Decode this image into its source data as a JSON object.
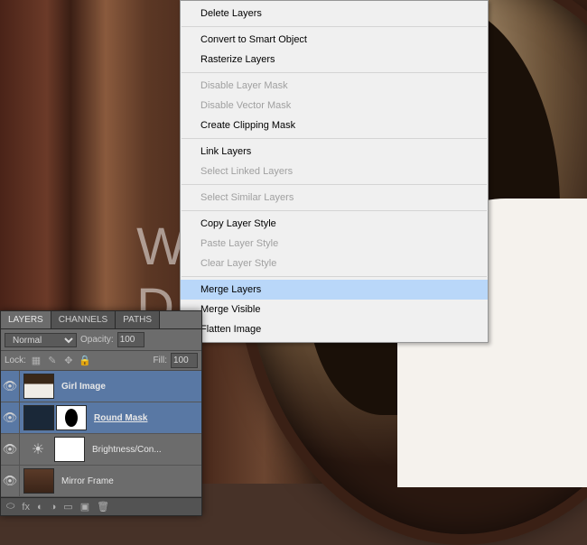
{
  "watermark": "WWW.PSD-DUDE.COM",
  "menu": {
    "delete": "Delete Layers",
    "convert": "Convert to Smart Object",
    "rasterize": "Rasterize Layers",
    "disableLM": "Disable Layer Mask",
    "disableVM": "Disable Vector Mask",
    "clip": "Create Clipping Mask",
    "link": "Link Layers",
    "selLinked": "Select Linked Layers",
    "selSimilar": "Select Similar Layers",
    "copyStyle": "Copy Layer Style",
    "pasteStyle": "Paste Layer Style",
    "clearStyle": "Clear Layer Style",
    "merge": "Merge Layers",
    "mergeVis": "Merge Visible",
    "flatten": "Flatten Image"
  },
  "panel": {
    "tabs": {
      "layers": "LAYERS",
      "channels": "CHANNELS",
      "paths": "PATHS"
    },
    "blend": "Normal",
    "opacityLabel": "Opacity:",
    "opacity": "100",
    "lockLabel": "Lock:",
    "fillLabel": "Fill:",
    "fill": "100",
    "layers": {
      "girl": "Girl Image",
      "round": "Round Mask",
      "bright": "Brightness/Con...",
      "mirror": "Mirror Frame"
    }
  }
}
